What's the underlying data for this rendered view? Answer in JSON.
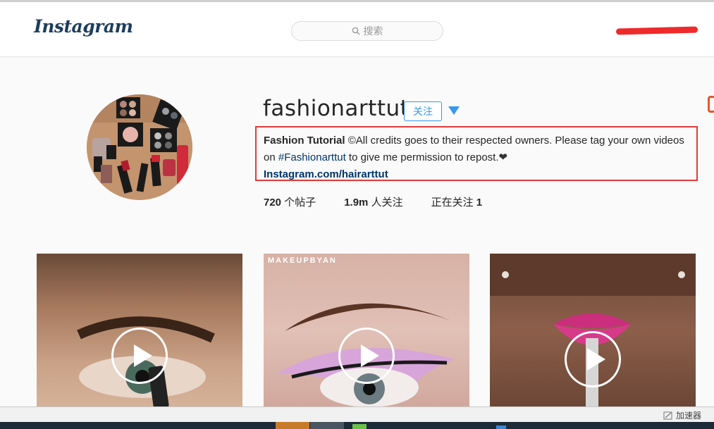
{
  "header": {
    "logo_text": "Instagram",
    "search_placeholder": "搜索"
  },
  "profile": {
    "username": "fashionarttut",
    "follow_label": "关注",
    "bio": {
      "name": "Fashion Tutorial",
      "text_1": " ©All credits goes to their respected owners. Please tag your own videos on ",
      "hashtag": "#Fashionarttut",
      "text_2": " to give me permission to repost.",
      "heart": "❤",
      "link": "Instagram.com/hairarttut"
    },
    "stats": {
      "posts_count": "720",
      "posts_label": " 个帖子",
      "followers_count": "1.9m",
      "followers_label": " 人关注",
      "following_label": "正在关注 ",
      "following_count": "1"
    }
  },
  "posts": [
    {
      "type": "video",
      "watermark": ""
    },
    {
      "type": "video",
      "watermark": "MAKEUPBYAN"
    },
    {
      "type": "video",
      "watermark": ""
    }
  ],
  "statusbar": {
    "accelerator_label": "加速器"
  },
  "colors": {
    "accent": "#3897f0",
    "highlight_box": "#e03a3a",
    "link": "#003569"
  }
}
